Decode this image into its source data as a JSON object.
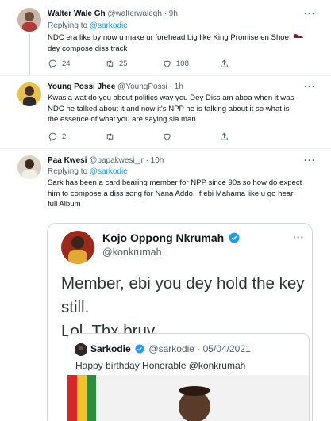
{
  "tweets": [
    {
      "name": "Walter Wale Gh",
      "handle": "@walterwalegh",
      "time": "· 9h",
      "replying_prefix": "Replying to",
      "replying_to": "@sarkodie",
      "text_line1": "NDC era like by now u make ur forehead big like King Promise en Shoe",
      "text_line2": "dey compose diss track",
      "replies": "24",
      "retweets": "25",
      "likes": "108"
    },
    {
      "name": "Young Possi Jhee",
      "handle": "@YoungPossi",
      "time": "· 1h",
      "text_line1": "Kwasia wat do you about politics way you Dey Diss am aboa when it was",
      "text_line2": "NDC he talked about it and now it's NPP he is talking about it so what is",
      "text_line3": "the essence of what you are saying sia man",
      "replies": "2"
    },
    {
      "name": "Paa Kwesi",
      "handle": "@papakwesi_jr",
      "time": "· 10h",
      "replying_prefix": "Replying to",
      "replying_to": "@sarkodie",
      "text_line1": "Sark has been a card bearing member for NPP since 90s so how do expect",
      "text_line2": "him to compose a diss song for Nana Addo. If ebi Mahama like u go hear",
      "text_line3": "full Album"
    }
  ],
  "embedded": {
    "name": "Kojo Oppong Nkrumah",
    "handle": "@konkrumah",
    "text_line1": "Member, ebi you dey hold the key still.",
    "text_line2": "Lol. Thx bruv.",
    "quoted": {
      "name": "Sarkodie",
      "handle": "@sarkodie",
      "date": "· 05/04/2021",
      "text": "Happy birthday Honorable @konkrumah"
    }
  },
  "more_label": "···",
  "colors": {
    "accent": "#1d9bf0",
    "verified": "#1d9bf0",
    "muted": "#536471",
    "border": "#cfd9de"
  }
}
